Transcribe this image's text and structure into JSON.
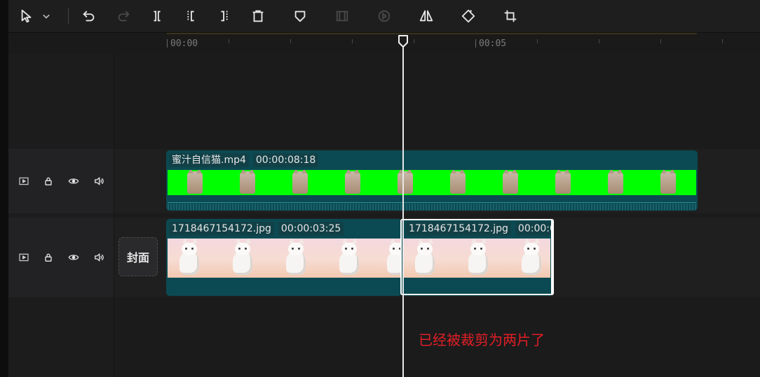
{
  "toolbar": {
    "tools": [
      {
        "icon": "select-pointer-icon"
      },
      {
        "icon": "chevron-down-icon"
      },
      {
        "icon": "undo-icon"
      },
      {
        "icon": "redo-icon",
        "disabled": true
      },
      {
        "icon": "split-icon"
      },
      {
        "icon": "trim-left-icon"
      },
      {
        "icon": "trim-right-icon"
      },
      {
        "icon": "delete-icon"
      },
      {
        "icon": "marker-icon"
      },
      {
        "icon": "freeze-frame-icon",
        "disabled": true
      },
      {
        "icon": "reverse-play-icon",
        "disabled": true
      },
      {
        "icon": "mirror-icon"
      },
      {
        "icon": "rotate-icon"
      },
      {
        "icon": "crop-icon"
      }
    ]
  },
  "ruler": {
    "label_0": "00:00",
    "label_5": "00:05"
  },
  "tracks": {
    "video_track": {
      "clip_name": "蜜汁自信猫.mp4",
      "clip_duration": "00:00:08:18"
    },
    "image_track": {
      "cover_label": "封面",
      "clip1_name": "1718467154172.jpg",
      "clip1_duration": "00:00:03:25",
      "clip2_name": "1718467154172.jpg",
      "clip2_duration": "00:00:0"
    }
  },
  "annotation": "已经被裁剪为两片了",
  "colors": {
    "clip_bg": "#0b4a52",
    "green_screen": "#00ff00",
    "annotation_red": "#e21f26",
    "playhead": "#e8e8e8"
  }
}
